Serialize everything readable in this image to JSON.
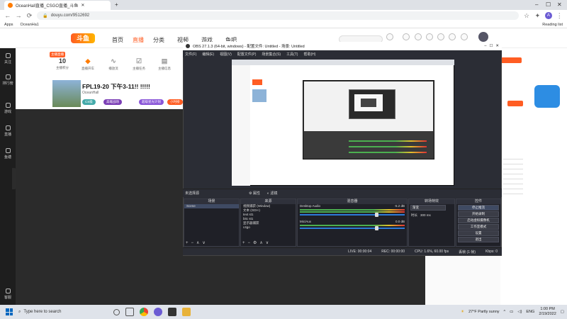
{
  "browser": {
    "tab_title": "OceanHall直播_CSGO直播_斗鱼",
    "url": "douyu.com/9512692",
    "bookmarks": [
      "Apps",
      "OceanHa1"
    ],
    "reading_list": "Reading list",
    "profile_initial": "A"
  },
  "douyu": {
    "logo": "斗鱼",
    "nav": [
      "首页",
      "直播",
      "分类",
      "视频",
      "游戏",
      "鱼吧"
    ],
    "sidebar": [
      "关注",
      "排行榜",
      "游戏",
      "直播",
      "鱼塘",
      "客服"
    ],
    "info_boxes": [
      {
        "num": "10",
        "label": "主播积分"
      },
      {
        "num": "",
        "label": "直播开车"
      },
      {
        "num": "",
        "label": "播放流"
      },
      {
        "num": "",
        "label": "主播任务"
      },
      {
        "num": "",
        "label": "主播信息"
      }
    ],
    "live_badge": "主播直播",
    "stream_title": "FPL19-20 下午3-11!! !!!!!",
    "streamer": "OceanHall",
    "tags": [
      "CS级",
      "高端战场",
      "超级星光计划",
      "小时榜"
    ]
  },
  "obs": {
    "title": "OBS 27.1.3 (64-bit, windows) - 配置文件: Untitled - 场景: Untitled",
    "menu": [
      "文件(F)",
      "编辑(E)",
      "视图(V)",
      "配置文件(P)",
      "场景集合(S)",
      "工具(T)",
      "帮助(H)"
    ],
    "source_bar": [
      "未选择源",
      "属性",
      "滤镜"
    ],
    "docks": {
      "scenes": {
        "title": "场景",
        "items": [
          "Scene"
        ]
      },
      "sources": {
        "title": "来源",
        "items": [
          "视频捕获 (Window)",
          "文本 (GDI+)",
          "text st1",
          "bitc st1",
          "显示器捕获",
          "c4go"
        ]
      },
      "mixer": {
        "title": "混音器",
        "channels": [
          {
            "name": "Desktop Audio",
            "db": "-5.2 dB"
          },
          {
            "name": "Mic/Aux",
            "db": "0.0 dB"
          }
        ]
      },
      "transitions": {
        "title": "转场特效",
        "type": "渐变",
        "duration_label": "时长",
        "duration": "300 ms"
      },
      "controls": {
        "title": "控件",
        "buttons": [
          "停止推流",
          "开始录制",
          "启动虚拟摄像机",
          "工作室模式",
          "设置",
          "退出"
        ]
      }
    },
    "status": [
      "LIVE: 00:00:04",
      "REC: 00:00:00",
      "CPU: 1.6%, 60.00 fps",
      "丢帧 (1 帧)",
      "Kbps: 0"
    ]
  },
  "taskbar": {
    "search_placeholder": "Type here to search",
    "weather": "27°F  Partly sunny",
    "lang": "ENG",
    "time": "1:00 PM",
    "date": "2/19/2022"
  },
  "colors": {
    "douyu_orange": "#ff5d23",
    "obs_bg": "#2b2d35",
    "dark_bg": "#2b2b2b"
  }
}
